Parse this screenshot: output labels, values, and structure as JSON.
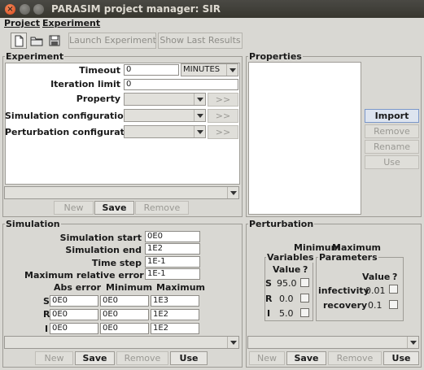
{
  "window": {
    "title": "PARASIM project manager: SIR",
    "close_glyph": "×"
  },
  "menu": {
    "project": "Project",
    "experiment": "Experiment"
  },
  "toolbar": {
    "launch_experiment": "Launch Experiment",
    "show_last_results": "Show Last Results",
    "icons": [
      "new-file-icon",
      "open-folder-icon",
      "save-disk-icon"
    ]
  },
  "experiment": {
    "title": "Experiment",
    "timeout_label": "Timeout",
    "timeout_value": "0",
    "timeout_unit": "MINUTES",
    "iteration_label": "Iteration limit",
    "iteration_value": "0",
    "property_label": "Property",
    "simulation_config_label": "Simulation configuration",
    "perturbation_config_label": "Perturbation configuration",
    "more_button": ">>",
    "buttons": {
      "new": "New",
      "save": "Save",
      "remove": "Remove"
    }
  },
  "properties": {
    "title": "Properties",
    "buttons": {
      "import": "Import",
      "remove": "Remove",
      "rename": "Rename",
      "use": "Use"
    }
  },
  "simulation": {
    "title": "Simulation",
    "start_label": "Simulation start",
    "start_value": "0E0",
    "end_label": "Simulation end",
    "end_value": "1E2",
    "timestep_label": "Time step",
    "timestep_value": "1E-1",
    "maxrel_label": "Maximum relative error",
    "maxrel_value": "1E-1",
    "columns": {
      "abs_error": "Abs error",
      "minimum": "Minimum",
      "maximum": "Maximum"
    },
    "rows": [
      {
        "var": "S",
        "abs": "0E0",
        "min": "0E0",
        "max": "1E3"
      },
      {
        "var": "R",
        "abs": "0E0",
        "min": "0E0",
        "max": "1E2"
      },
      {
        "var": "I",
        "abs": "0E0",
        "min": "0E0",
        "max": "1E2"
      }
    ],
    "buttons": {
      "new": "New",
      "save": "Save",
      "remove": "Remove",
      "use": "Use"
    }
  },
  "perturbation": {
    "title": "Perturbation",
    "minimum_header": "Minimum",
    "maximum_header": "Maximum",
    "variables": {
      "title": "Variables",
      "value_header": "Value",
      "q_header": "?",
      "rows": [
        {
          "var": "S",
          "value": "95.0"
        },
        {
          "var": "R",
          "value": "0.0"
        },
        {
          "var": "I",
          "value": "5.0"
        }
      ]
    },
    "parameters": {
      "title": "Parameters",
      "value_header": "Value",
      "q_header": "?",
      "rows": [
        {
          "name": "infectivity",
          "value": "0.01"
        },
        {
          "name": "recovery",
          "value": "0.1"
        }
      ]
    },
    "buttons": {
      "new": "New",
      "save": "Save",
      "remove": "Remove",
      "use": "Use"
    }
  }
}
